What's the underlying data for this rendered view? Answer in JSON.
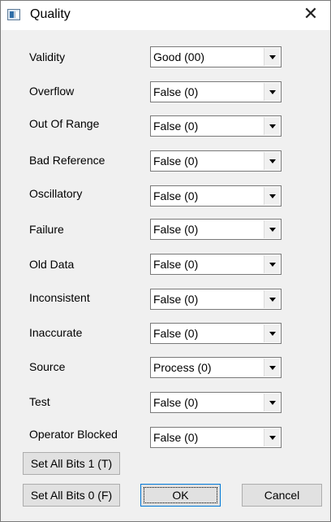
{
  "window": {
    "title": "Quality",
    "close_glyph": "✕"
  },
  "fields": [
    {
      "label": "Validity",
      "value": "Good (00)"
    },
    {
      "label": "Overflow",
      "value": "False (0)"
    },
    {
      "label": "Out Of Range",
      "value": "False (0)"
    },
    {
      "label": "Bad Reference",
      "value": "False (0)"
    },
    {
      "label": "Oscillatory",
      "value": "False (0)"
    },
    {
      "label": "Failure",
      "value": "False (0)"
    },
    {
      "label": "Old Data",
      "value": "False (0)"
    },
    {
      "label": "Inconsistent",
      "value": "False (0)"
    },
    {
      "label": "Inaccurate",
      "value": "False (0)"
    },
    {
      "label": "Source",
      "value": "Process (0)"
    },
    {
      "label": "Test",
      "value": "False (0)"
    },
    {
      "label": "Operator Blocked",
      "value": "False (0)"
    }
  ],
  "buttons": {
    "set_all_1": "Set All Bits 1 (T)",
    "set_all_0": "Set All Bits 0 (F)",
    "ok": "OK",
    "cancel": "Cancel"
  }
}
